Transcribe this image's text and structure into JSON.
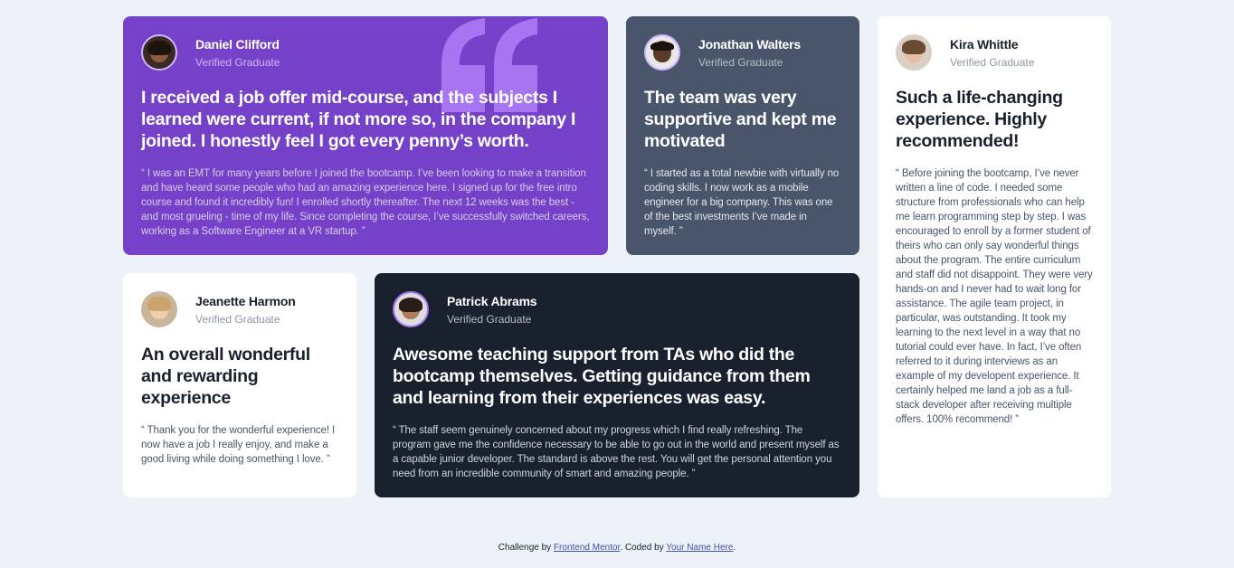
{
  "testimonials": [
    {
      "name": "Daniel Clifford",
      "role": "Verified Graduate",
      "title": "I received a job offer mid-course, and the subjects I learned were current, if not more so, in the company I joined. I honestly feel I got every penny’s worth.",
      "quote": "“ I was an EMT for many years before I joined the bootcamp. I’ve been looking to make a transition and have heard some people who had an amazing experience here. I signed up for the free intro course and found it incredibly fun! I enrolled shortly thereafter. The next 12 weeks was the best - and most grueling - time of my life. Since completing the course, I’ve successfully switched careers, working as a Software Engineer at a VR startup. ”",
      "accent": "#7541c8"
    },
    {
      "name": "Jonathan Walters",
      "role": "Verified Graduate",
      "title": "The team was very supportive and kept me motivated",
      "quote": "“ I started as a total newbie with virtually no coding skills. I now work as a mobile engineer for a big company. This was one of the best investments I’ve made in myself. ”",
      "accent": "#48556a"
    },
    {
      "name": "Kira Whittle",
      "role": "Verified Graduate",
      "title": "Such a life-changing experience. Highly recommended!",
      "quote": "“ Before joining the bootcamp, I’ve never written a line of code. I needed some structure from professionals who can help me learn programming step by step. I was encouraged to enroll by a former student of theirs who can only say wonderful things about the program. The entire curriculum and staff did not disappoint. They were very hands-on and I never had to wait long for assistance. The agile team project, in particular, was outstanding. It took my learning to the next level in a way that no tutorial could ever have. In fact, I’ve often referred to it during interviews as an example of my developent experience. It certainly helped me land a job as a full-stack developer after receiving multiple offers. 100% recommend! ”",
      "accent": "#ffffff"
    },
    {
      "name": "Jeanette Harmon",
      "role": "Verified Graduate",
      "title": "An overall wonderful and rewarding experience",
      "quote": "“ Thank you for the wonderful experience! I now have a job I really enjoy, and make a good living while doing something I love. ”",
      "accent": "#ffffff"
    },
    {
      "name": "Patrick Abrams",
      "role": "Verified Graduate",
      "title": "Awesome teaching support from TAs who did the bootcamp themselves. Getting guidance from them and learning from their experiences was easy.",
      "quote": "“ The staff seem genuinely concerned about my progress which I find really refreshing. The program gave me the confidence necessary to be able to go out in the world and present myself as a capable junior developer. The standard is above the rest. You will get the personal attention you need from an incredible community of smart and amazing people. ”",
      "accent": "#19212e"
    }
  ],
  "footer": {
    "prefix": "Challenge by ",
    "link1": "Frontend Mentor",
    "middle": ". Coded by ",
    "link2": "Your Name Here",
    "suffix": "."
  },
  "colors": {
    "background": "#edf2f8",
    "purple": "#7541c8",
    "slate": "#48556a",
    "dark": "#19212e",
    "white": "#ffffff",
    "quote_mark": "#a775f1"
  },
  "icons": [
    "quotation-mark-icon"
  ]
}
